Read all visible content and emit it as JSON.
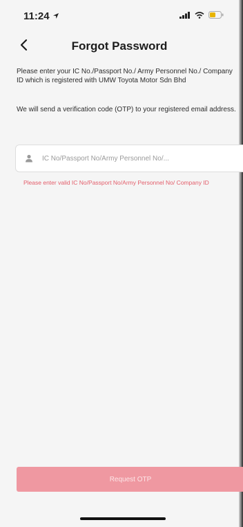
{
  "status_bar": {
    "time": "11:24",
    "icons": [
      "location-arrow-icon",
      "signal-icon",
      "wifi-icon",
      "battery-icon"
    ]
  },
  "header": {
    "back_icon": "chevron-left-icon",
    "title": "Forgot Password"
  },
  "form": {
    "description_1": "Please enter your IC No./Passport No./ Army Personnel No./ Company ID which is registered with UMW Toyota Motor Sdn Bhd",
    "description_2": "We will send a verification code (OTP) to your registered email address.",
    "input_placeholder": "IC No/Passport No/Army Personnel No/...",
    "input_icon": "user-icon",
    "error_message": "Please enter valid IC No/Passport No/Army Personnel No/ Company ID",
    "submit_label": "Request OTP"
  },
  "colors": {
    "error": "#e35d6a",
    "button_disabled": "#ef98a1",
    "battery": "#e8b400"
  }
}
